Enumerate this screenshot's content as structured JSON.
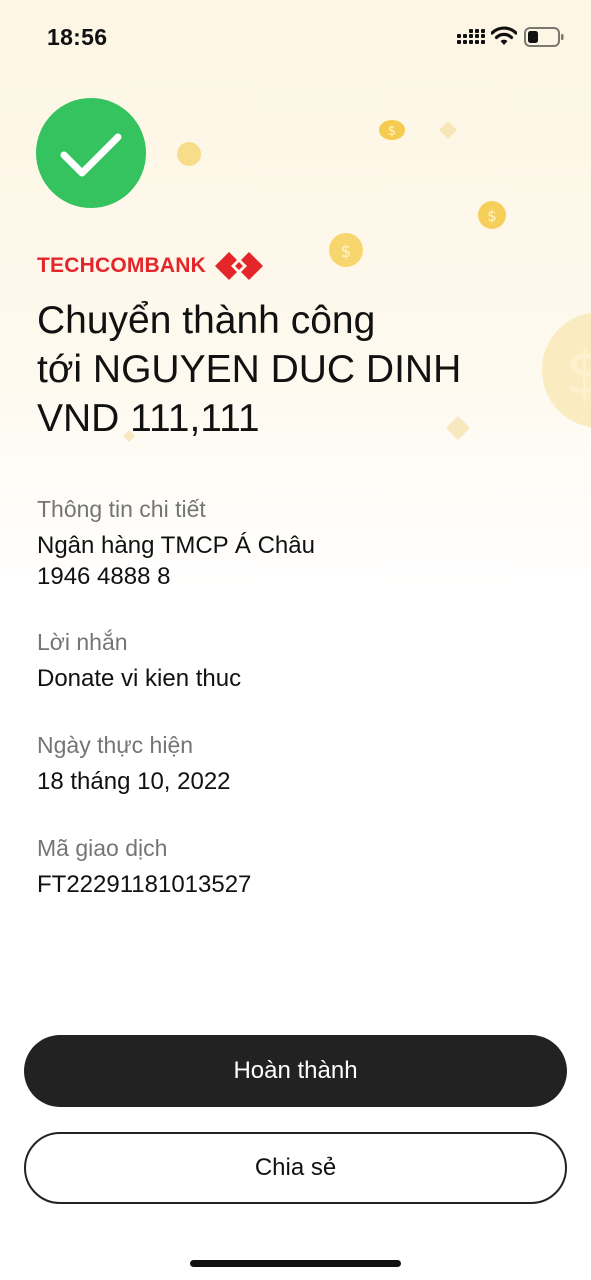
{
  "status_bar": {
    "time": "18:56",
    "icons": [
      "cellular-signal-icon",
      "wifi-icon",
      "battery-icon"
    ]
  },
  "brand": {
    "name": "TECHCOMBANK",
    "logo_icon": "techcombank-logo-icon",
    "color": "#e4262b"
  },
  "success": {
    "icon": "checkmark-icon",
    "color": "#34c35f"
  },
  "headline": {
    "line1": "Chuyển thành công",
    "line2": "tới NGUYEN DUC DINH",
    "amount": "VND 111,111"
  },
  "details": {
    "info": {
      "label": "Thông tin chi tiết",
      "bank": "Ngân hàng TMCP Á Châu",
      "account": "1946 4888 8"
    },
    "message": {
      "label": "Lời nhắn",
      "value": "Donate vi kien thuc"
    },
    "date": {
      "label": "Ngày thực hiện",
      "value": "18 tháng 10, 2022"
    },
    "transaction": {
      "label": "Mã giao dịch",
      "value": "FT22291181013527"
    }
  },
  "buttons": {
    "done": "Hoàn thành",
    "share": "Chia sẻ"
  },
  "colors": {
    "primary_button": "#222222",
    "coin": "#f6cf5a",
    "background_top": "#fdf6e4"
  }
}
